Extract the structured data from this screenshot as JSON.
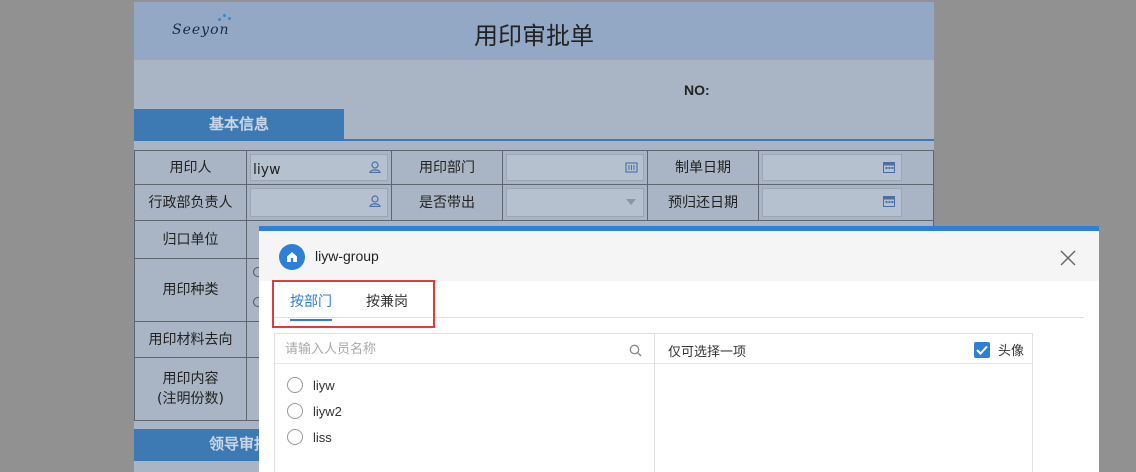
{
  "form": {
    "logo": "Seeyon",
    "title": "用印审批单",
    "no_label": "NO:",
    "section_basic": "基本信息",
    "section_leader": "领导审批",
    "rows": {
      "applicant_label": "用印人",
      "applicant_value": "liyw",
      "dept_label": "用印部门",
      "date_label": "制单日期",
      "admin_label": "行政部负责人",
      "takeout_label": "是否带出",
      "return_date_label": "预归还日期",
      "unit_label": "归口单位",
      "type_label": "用印种类",
      "material_label": "用印材料去向",
      "content_label_1": "用印内容",
      "content_label_2": "(注明份数)"
    }
  },
  "dialog": {
    "title": "liyw-group",
    "tabs": [
      "按部门",
      "按兼岗"
    ],
    "search_placeholder": "请输入人员名称",
    "people": [
      "liyw",
      "liyw2",
      "liss"
    ],
    "right_title": "仅可选择一项",
    "avatar_label": "头像",
    "avatar_checked": true
  },
  "colors": {
    "accent": "#2e7fd6",
    "highlight": "#e03a3a"
  }
}
